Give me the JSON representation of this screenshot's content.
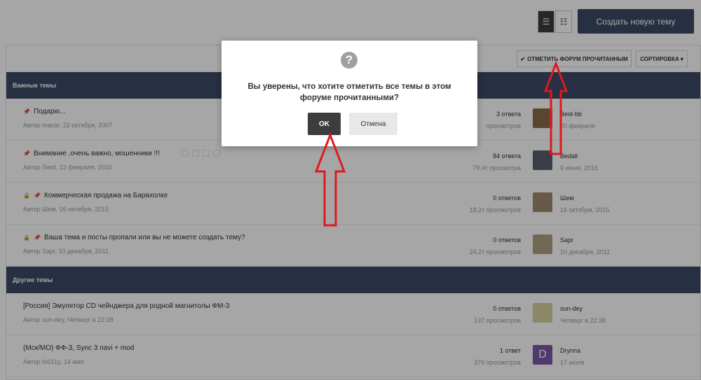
{
  "toolbar": {
    "create_topic_label": "Создать новую тему",
    "list_view_icon": "list-icon",
    "grid_view_icon": "grid-list-icon"
  },
  "forum_toolbar": {
    "mark_read_label": "ОТМЕТИТЬ ФОРУМ ПРОЧИТАННЫМ",
    "sort_label": "СОРТИРОВКА"
  },
  "sections": {
    "important": "Важные темы",
    "other": "Другие темы"
  },
  "topics": [
    {
      "title": "Подарю...",
      "meta": "Автор macar, 22 октября, 2007",
      "replies": "3 ответа",
      "views": "просмотров",
      "last_author": "Best-bb",
      "last_date": "20 февраля",
      "avatar_color": "#8a6a4a"
    },
    {
      "title": "Внимание ,очень важно, мошенники !!!",
      "meta": "Автор Swol, 13 февраля, 2010",
      "replies": "84 ответа",
      "views": "79,4т просмотра",
      "last_author": "Bedall",
      "last_date": "9 июня, 2016",
      "avatar_color": "#5a6070"
    },
    {
      "title": "Коммерческая продажа на Барахолке",
      "meta": "Автор Шем, 16 октября, 2015",
      "replies": "0 ответов",
      "views": "18,2т просмотров",
      "last_author": "Шем",
      "last_date": "16 октября, 2015",
      "avatar_color": "#a08a70"
    },
    {
      "title": "Ваша тема и посты пропали или вы не можете создать тему?",
      "meta": "Автор Sapr, 10 декабря, 2011",
      "replies": "0 ответов",
      "views": "24,2т просмотров",
      "last_author": "Sapr",
      "last_date": "10 декабря, 2011",
      "avatar_color": "#b0a080"
    },
    {
      "title": "[Россия] Эмулятор CD чейнджера для родной магнитолы ФМ-3",
      "meta": "Автор sun-dey, Четверг в 22:38",
      "replies": "0 ответов",
      "views": "137 просмотров",
      "last_author": "sun-dey",
      "last_date": "Четверг в 22:38",
      "avatar_color": "#d8d0a0"
    },
    {
      "title": "(Мск/МО) ФФ-3, Sync 3 navi + mod",
      "meta": "Автор fo011y, 14 мая",
      "replies": "1 ответ",
      "views": "376 просмотров",
      "last_author": "Drynna",
      "last_date": "17 июля",
      "avatar_letter": "D",
      "avatar_color": "#7b5aa8"
    }
  ],
  "modal": {
    "icon": "question-circle-icon",
    "message": "Вы уверены, что хотите отметить все темы в этом форуме прочитанными?",
    "ok_label": "OK",
    "cancel_label": "Отмена"
  },
  "colors": {
    "header_bg": "#3d4a66",
    "arrow": "#e0191e",
    "ok_bg": "#3d3d3d"
  }
}
